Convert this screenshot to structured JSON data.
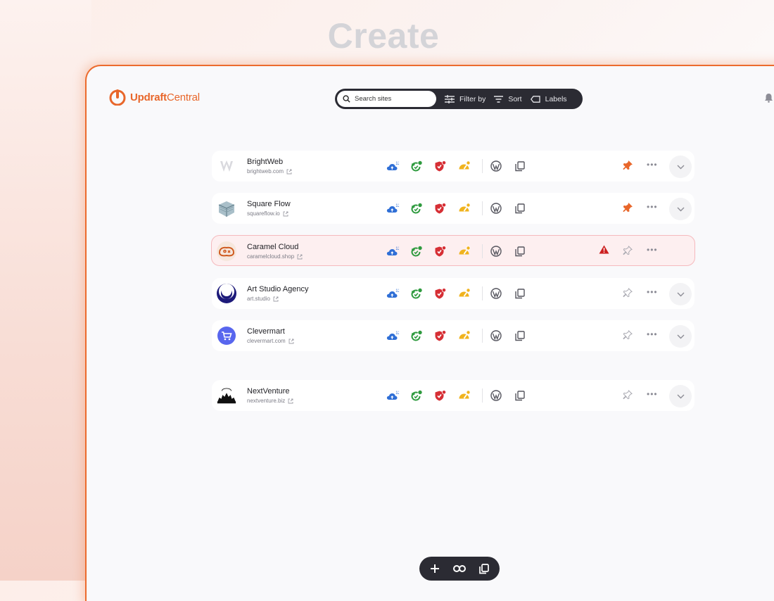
{
  "heading": "Create",
  "app": {
    "name_bold": "Updraft",
    "name_light": "Central",
    "accent": "#e8662a"
  },
  "toolbar": {
    "search_placeholder": "Search sites",
    "filter_label": "Filter by",
    "sort_label": "Sort",
    "labels_label": "Labels"
  },
  "sites": [
    {
      "name": "BrightWeb",
      "url": "brightweb.com",
      "pinned": true,
      "warning": false
    },
    {
      "name": "Square Flow",
      "url": "squareflow.io",
      "pinned": true,
      "warning": false
    },
    {
      "name": "Caramel Cloud",
      "url": "caramelcloud.shop",
      "pinned": false,
      "warning": true
    },
    {
      "name": "Art Studio Agency",
      "url": "art.studio",
      "pinned": false,
      "warning": false
    },
    {
      "name": "Clevermart",
      "url": "clevermart.com",
      "pinned": false,
      "warning": false
    },
    {
      "name": "NextVenture",
      "url": "nextventure.biz",
      "pinned": false,
      "warning": false
    }
  ],
  "status_icons": [
    "backup-cloud-icon",
    "update-icon",
    "security-shield-icon",
    "performance-gauge-icon"
  ],
  "colors": {
    "backup": "#2f6fd6",
    "update": "#2e9a3e",
    "security": "#d62f35",
    "performance": "#f0b31e",
    "pin_active": "#e8662a",
    "warning": "#cc1f1f"
  },
  "bottom_bar": [
    "add-icon",
    "link-icon",
    "copy-icon"
  ]
}
